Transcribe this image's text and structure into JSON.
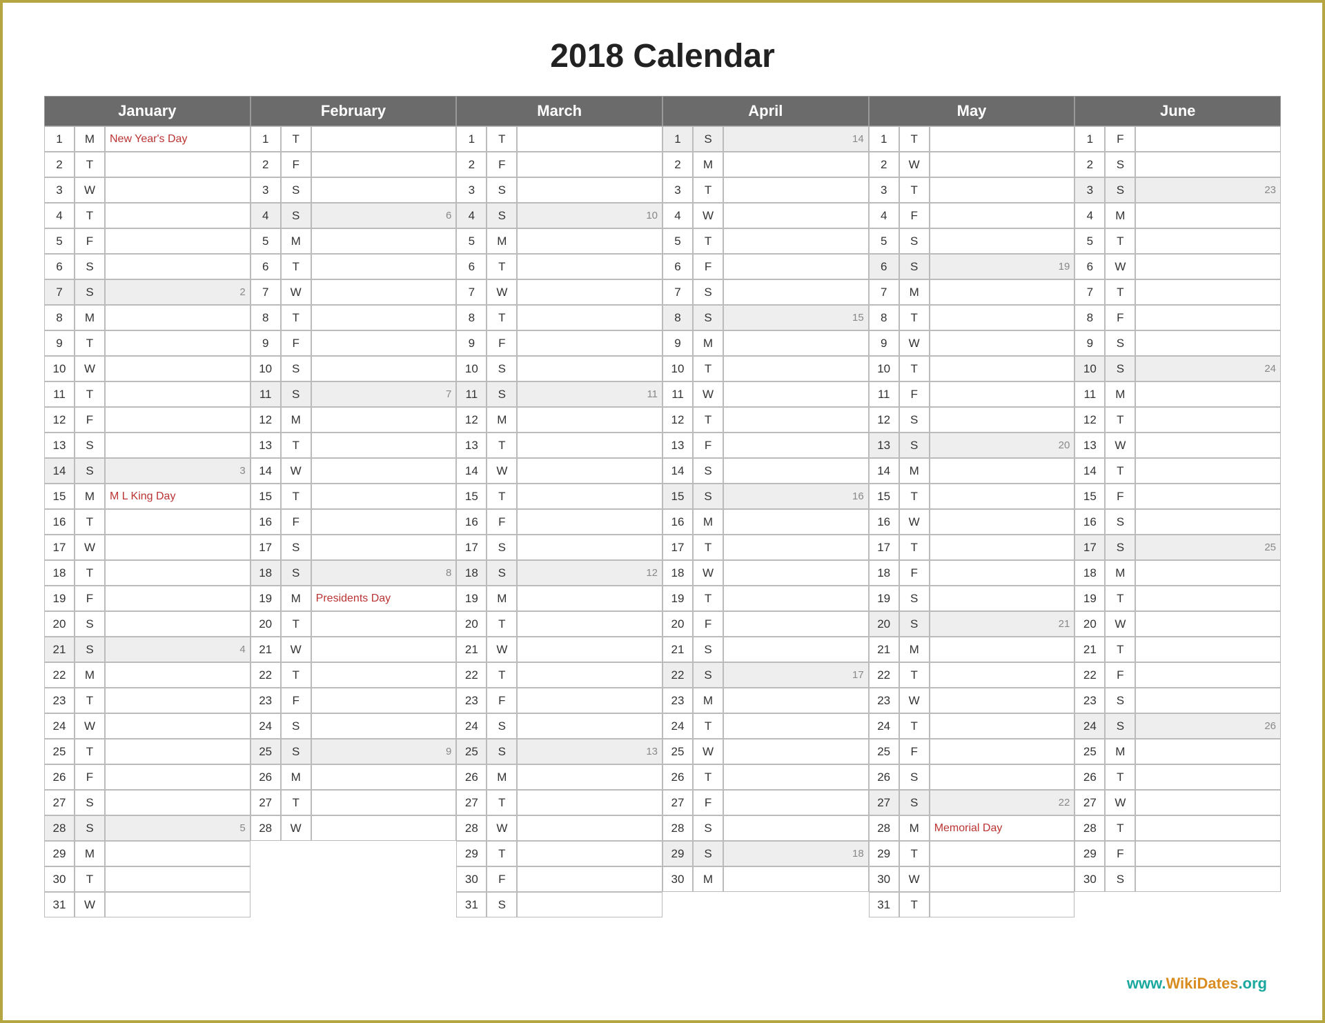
{
  "title": "2018 Calendar",
  "footer": {
    "text1": "www.",
    "text2": "WikiDates",
    "text3": ".org"
  },
  "months": [
    {
      "name": "January",
      "days": [
        {
          "n": "1",
          "d": "M",
          "ev": "New Year's Day",
          "wn": ""
        },
        {
          "n": "2",
          "d": "T",
          "ev": "",
          "wn": ""
        },
        {
          "n": "3",
          "d": "W",
          "ev": "",
          "wn": ""
        },
        {
          "n": "4",
          "d": "T",
          "ev": "",
          "wn": ""
        },
        {
          "n": "5",
          "d": "F",
          "ev": "",
          "wn": ""
        },
        {
          "n": "6",
          "d": "S",
          "ev": "",
          "wn": ""
        },
        {
          "n": "7",
          "d": "S",
          "ev": "",
          "wn": "2",
          "sun": true
        },
        {
          "n": "8",
          "d": "M",
          "ev": "",
          "wn": ""
        },
        {
          "n": "9",
          "d": "T",
          "ev": "",
          "wn": ""
        },
        {
          "n": "10",
          "d": "W",
          "ev": "",
          "wn": ""
        },
        {
          "n": "11",
          "d": "T",
          "ev": "",
          "wn": ""
        },
        {
          "n": "12",
          "d": "F",
          "ev": "",
          "wn": ""
        },
        {
          "n": "13",
          "d": "S",
          "ev": "",
          "wn": ""
        },
        {
          "n": "14",
          "d": "S",
          "ev": "",
          "wn": "3",
          "sun": true
        },
        {
          "n": "15",
          "d": "M",
          "ev": "M L King Day",
          "wn": ""
        },
        {
          "n": "16",
          "d": "T",
          "ev": "",
          "wn": ""
        },
        {
          "n": "17",
          "d": "W",
          "ev": "",
          "wn": ""
        },
        {
          "n": "18",
          "d": "T",
          "ev": "",
          "wn": ""
        },
        {
          "n": "19",
          "d": "F",
          "ev": "",
          "wn": ""
        },
        {
          "n": "20",
          "d": "S",
          "ev": "",
          "wn": ""
        },
        {
          "n": "21",
          "d": "S",
          "ev": "",
          "wn": "4",
          "sun": true
        },
        {
          "n": "22",
          "d": "M",
          "ev": "",
          "wn": ""
        },
        {
          "n": "23",
          "d": "T",
          "ev": "",
          "wn": ""
        },
        {
          "n": "24",
          "d": "W",
          "ev": "",
          "wn": ""
        },
        {
          "n": "25",
          "d": "T",
          "ev": "",
          "wn": ""
        },
        {
          "n": "26",
          "d": "F",
          "ev": "",
          "wn": ""
        },
        {
          "n": "27",
          "d": "S",
          "ev": "",
          "wn": ""
        },
        {
          "n": "28",
          "d": "S",
          "ev": "",
          "wn": "5",
          "sun": true
        },
        {
          "n": "29",
          "d": "M",
          "ev": "",
          "wn": ""
        },
        {
          "n": "30",
          "d": "T",
          "ev": "",
          "wn": ""
        },
        {
          "n": "31",
          "d": "W",
          "ev": "",
          "wn": ""
        }
      ]
    },
    {
      "name": "February",
      "days": [
        {
          "n": "1",
          "d": "T",
          "ev": "",
          "wn": ""
        },
        {
          "n": "2",
          "d": "F",
          "ev": "",
          "wn": ""
        },
        {
          "n": "3",
          "d": "S",
          "ev": "",
          "wn": ""
        },
        {
          "n": "4",
          "d": "S",
          "ev": "",
          "wn": "6",
          "sun": true
        },
        {
          "n": "5",
          "d": "M",
          "ev": "",
          "wn": ""
        },
        {
          "n": "6",
          "d": "T",
          "ev": "",
          "wn": ""
        },
        {
          "n": "7",
          "d": "W",
          "ev": "",
          "wn": ""
        },
        {
          "n": "8",
          "d": "T",
          "ev": "",
          "wn": ""
        },
        {
          "n": "9",
          "d": "F",
          "ev": "",
          "wn": ""
        },
        {
          "n": "10",
          "d": "S",
          "ev": "",
          "wn": ""
        },
        {
          "n": "11",
          "d": "S",
          "ev": "",
          "wn": "7",
          "sun": true
        },
        {
          "n": "12",
          "d": "M",
          "ev": "",
          "wn": ""
        },
        {
          "n": "13",
          "d": "T",
          "ev": "",
          "wn": ""
        },
        {
          "n": "14",
          "d": "W",
          "ev": "",
          "wn": ""
        },
        {
          "n": "15",
          "d": "T",
          "ev": "",
          "wn": ""
        },
        {
          "n": "16",
          "d": "F",
          "ev": "",
          "wn": ""
        },
        {
          "n": "17",
          "d": "S",
          "ev": "",
          "wn": ""
        },
        {
          "n": "18",
          "d": "S",
          "ev": "",
          "wn": "8",
          "sun": true
        },
        {
          "n": "19",
          "d": "M",
          "ev": "Presidents Day",
          "wn": ""
        },
        {
          "n": "20",
          "d": "T",
          "ev": "",
          "wn": ""
        },
        {
          "n": "21",
          "d": "W",
          "ev": "",
          "wn": ""
        },
        {
          "n": "22",
          "d": "T",
          "ev": "",
          "wn": ""
        },
        {
          "n": "23",
          "d": "F",
          "ev": "",
          "wn": ""
        },
        {
          "n": "24",
          "d": "S",
          "ev": "",
          "wn": ""
        },
        {
          "n": "25",
          "d": "S",
          "ev": "",
          "wn": "9",
          "sun": true
        },
        {
          "n": "26",
          "d": "M",
          "ev": "",
          "wn": ""
        },
        {
          "n": "27",
          "d": "T",
          "ev": "",
          "wn": ""
        },
        {
          "n": "28",
          "d": "W",
          "ev": "",
          "wn": ""
        }
      ]
    },
    {
      "name": "March",
      "days": [
        {
          "n": "1",
          "d": "T",
          "ev": "",
          "wn": ""
        },
        {
          "n": "2",
          "d": "F",
          "ev": "",
          "wn": ""
        },
        {
          "n": "3",
          "d": "S",
          "ev": "",
          "wn": ""
        },
        {
          "n": "4",
          "d": "S",
          "ev": "",
          "wn": "10",
          "sun": true
        },
        {
          "n": "5",
          "d": "M",
          "ev": "",
          "wn": ""
        },
        {
          "n": "6",
          "d": "T",
          "ev": "",
          "wn": ""
        },
        {
          "n": "7",
          "d": "W",
          "ev": "",
          "wn": ""
        },
        {
          "n": "8",
          "d": "T",
          "ev": "",
          "wn": ""
        },
        {
          "n": "9",
          "d": "F",
          "ev": "",
          "wn": ""
        },
        {
          "n": "10",
          "d": "S",
          "ev": "",
          "wn": ""
        },
        {
          "n": "11",
          "d": "S",
          "ev": "",
          "wn": "11",
          "sun": true
        },
        {
          "n": "12",
          "d": "M",
          "ev": "",
          "wn": ""
        },
        {
          "n": "13",
          "d": "T",
          "ev": "",
          "wn": ""
        },
        {
          "n": "14",
          "d": "W",
          "ev": "",
          "wn": ""
        },
        {
          "n": "15",
          "d": "T",
          "ev": "",
          "wn": ""
        },
        {
          "n": "16",
          "d": "F",
          "ev": "",
          "wn": ""
        },
        {
          "n": "17",
          "d": "S",
          "ev": "",
          "wn": ""
        },
        {
          "n": "18",
          "d": "S",
          "ev": "",
          "wn": "12",
          "sun": true
        },
        {
          "n": "19",
          "d": "M",
          "ev": "",
          "wn": ""
        },
        {
          "n": "20",
          "d": "T",
          "ev": "",
          "wn": ""
        },
        {
          "n": "21",
          "d": "W",
          "ev": "",
          "wn": ""
        },
        {
          "n": "22",
          "d": "T",
          "ev": "",
          "wn": ""
        },
        {
          "n": "23",
          "d": "F",
          "ev": "",
          "wn": ""
        },
        {
          "n": "24",
          "d": "S",
          "ev": "",
          "wn": ""
        },
        {
          "n": "25",
          "d": "S",
          "ev": "",
          "wn": "13",
          "sun": true
        },
        {
          "n": "26",
          "d": "M",
          "ev": "",
          "wn": ""
        },
        {
          "n": "27",
          "d": "T",
          "ev": "",
          "wn": ""
        },
        {
          "n": "28",
          "d": "W",
          "ev": "",
          "wn": ""
        },
        {
          "n": "29",
          "d": "T",
          "ev": "",
          "wn": ""
        },
        {
          "n": "30",
          "d": "F",
          "ev": "",
          "wn": ""
        },
        {
          "n": "31",
          "d": "S",
          "ev": "",
          "wn": ""
        }
      ]
    },
    {
      "name": "April",
      "days": [
        {
          "n": "1",
          "d": "S",
          "ev": "",
          "wn": "14",
          "sun": true
        },
        {
          "n": "2",
          "d": "M",
          "ev": "",
          "wn": ""
        },
        {
          "n": "3",
          "d": "T",
          "ev": "",
          "wn": ""
        },
        {
          "n": "4",
          "d": "W",
          "ev": "",
          "wn": ""
        },
        {
          "n": "5",
          "d": "T",
          "ev": "",
          "wn": ""
        },
        {
          "n": "6",
          "d": "F",
          "ev": "",
          "wn": ""
        },
        {
          "n": "7",
          "d": "S",
          "ev": "",
          "wn": ""
        },
        {
          "n": "8",
          "d": "S",
          "ev": "",
          "wn": "15",
          "sun": true
        },
        {
          "n": "9",
          "d": "M",
          "ev": "",
          "wn": ""
        },
        {
          "n": "10",
          "d": "T",
          "ev": "",
          "wn": ""
        },
        {
          "n": "11",
          "d": "W",
          "ev": "",
          "wn": ""
        },
        {
          "n": "12",
          "d": "T",
          "ev": "",
          "wn": ""
        },
        {
          "n": "13",
          "d": "F",
          "ev": "",
          "wn": ""
        },
        {
          "n": "14",
          "d": "S",
          "ev": "",
          "wn": ""
        },
        {
          "n": "15",
          "d": "S",
          "ev": "",
          "wn": "16",
          "sun": true
        },
        {
          "n": "16",
          "d": "M",
          "ev": "",
          "wn": ""
        },
        {
          "n": "17",
          "d": "T",
          "ev": "",
          "wn": ""
        },
        {
          "n": "18",
          "d": "W",
          "ev": "",
          "wn": ""
        },
        {
          "n": "19",
          "d": "T",
          "ev": "",
          "wn": ""
        },
        {
          "n": "20",
          "d": "F",
          "ev": "",
          "wn": ""
        },
        {
          "n": "21",
          "d": "S",
          "ev": "",
          "wn": ""
        },
        {
          "n": "22",
          "d": "S",
          "ev": "",
          "wn": "17",
          "sun": true
        },
        {
          "n": "23",
          "d": "M",
          "ev": "",
          "wn": ""
        },
        {
          "n": "24",
          "d": "T",
          "ev": "",
          "wn": ""
        },
        {
          "n": "25",
          "d": "W",
          "ev": "",
          "wn": ""
        },
        {
          "n": "26",
          "d": "T",
          "ev": "",
          "wn": ""
        },
        {
          "n": "27",
          "d": "F",
          "ev": "",
          "wn": ""
        },
        {
          "n": "28",
          "d": "S",
          "ev": "",
          "wn": ""
        },
        {
          "n": "29",
          "d": "S",
          "ev": "",
          "wn": "18",
          "sun": true
        },
        {
          "n": "30",
          "d": "M",
          "ev": "",
          "wn": ""
        }
      ]
    },
    {
      "name": "May",
      "days": [
        {
          "n": "1",
          "d": "T",
          "ev": "",
          "wn": ""
        },
        {
          "n": "2",
          "d": "W",
          "ev": "",
          "wn": ""
        },
        {
          "n": "3",
          "d": "T",
          "ev": "",
          "wn": ""
        },
        {
          "n": "4",
          "d": "F",
          "ev": "",
          "wn": ""
        },
        {
          "n": "5",
          "d": "S",
          "ev": "",
          "wn": ""
        },
        {
          "n": "6",
          "d": "S",
          "ev": "",
          "wn": "19",
          "sun": true
        },
        {
          "n": "7",
          "d": "M",
          "ev": "",
          "wn": ""
        },
        {
          "n": "8",
          "d": "T",
          "ev": "",
          "wn": ""
        },
        {
          "n": "9",
          "d": "W",
          "ev": "",
          "wn": ""
        },
        {
          "n": "10",
          "d": "T",
          "ev": "",
          "wn": ""
        },
        {
          "n": "11",
          "d": "F",
          "ev": "",
          "wn": ""
        },
        {
          "n": "12",
          "d": "S",
          "ev": "",
          "wn": ""
        },
        {
          "n": "13",
          "d": "S",
          "ev": "",
          "wn": "20",
          "sun": true
        },
        {
          "n": "14",
          "d": "M",
          "ev": "",
          "wn": ""
        },
        {
          "n": "15",
          "d": "T",
          "ev": "",
          "wn": ""
        },
        {
          "n": "16",
          "d": "W",
          "ev": "",
          "wn": ""
        },
        {
          "n": "17",
          "d": "T",
          "ev": "",
          "wn": ""
        },
        {
          "n": "18",
          "d": "F",
          "ev": "",
          "wn": ""
        },
        {
          "n": "19",
          "d": "S",
          "ev": "",
          "wn": ""
        },
        {
          "n": "20",
          "d": "S",
          "ev": "",
          "wn": "21",
          "sun": true
        },
        {
          "n": "21",
          "d": "M",
          "ev": "",
          "wn": ""
        },
        {
          "n": "22",
          "d": "T",
          "ev": "",
          "wn": ""
        },
        {
          "n": "23",
          "d": "W",
          "ev": "",
          "wn": ""
        },
        {
          "n": "24",
          "d": "T",
          "ev": "",
          "wn": ""
        },
        {
          "n": "25",
          "d": "F",
          "ev": "",
          "wn": ""
        },
        {
          "n": "26",
          "d": "S",
          "ev": "",
          "wn": ""
        },
        {
          "n": "27",
          "d": "S",
          "ev": "",
          "wn": "22",
          "sun": true
        },
        {
          "n": "28",
          "d": "M",
          "ev": "Memorial Day",
          "wn": ""
        },
        {
          "n": "29",
          "d": "T",
          "ev": "",
          "wn": ""
        },
        {
          "n": "30",
          "d": "W",
          "ev": "",
          "wn": ""
        },
        {
          "n": "31",
          "d": "T",
          "ev": "",
          "wn": ""
        }
      ]
    },
    {
      "name": "June",
      "days": [
        {
          "n": "1",
          "d": "F",
          "ev": "",
          "wn": ""
        },
        {
          "n": "2",
          "d": "S",
          "ev": "",
          "wn": ""
        },
        {
          "n": "3",
          "d": "S",
          "ev": "",
          "wn": "23",
          "sun": true
        },
        {
          "n": "4",
          "d": "M",
          "ev": "",
          "wn": ""
        },
        {
          "n": "5",
          "d": "T",
          "ev": "",
          "wn": ""
        },
        {
          "n": "6",
          "d": "W",
          "ev": "",
          "wn": ""
        },
        {
          "n": "7",
          "d": "T",
          "ev": "",
          "wn": ""
        },
        {
          "n": "8",
          "d": "F",
          "ev": "",
          "wn": ""
        },
        {
          "n": "9",
          "d": "S",
          "ev": "",
          "wn": ""
        },
        {
          "n": "10",
          "d": "S",
          "ev": "",
          "wn": "24",
          "sun": true
        },
        {
          "n": "11",
          "d": "M",
          "ev": "",
          "wn": ""
        },
        {
          "n": "12",
          "d": "T",
          "ev": "",
          "wn": ""
        },
        {
          "n": "13",
          "d": "W",
          "ev": "",
          "wn": ""
        },
        {
          "n": "14",
          "d": "T",
          "ev": "",
          "wn": ""
        },
        {
          "n": "15",
          "d": "F",
          "ev": "",
          "wn": ""
        },
        {
          "n": "16",
          "d": "S",
          "ev": "",
          "wn": ""
        },
        {
          "n": "17",
          "d": "S",
          "ev": "",
          "wn": "25",
          "sun": true
        },
        {
          "n": "18",
          "d": "M",
          "ev": "",
          "wn": ""
        },
        {
          "n": "19",
          "d": "T",
          "ev": "",
          "wn": ""
        },
        {
          "n": "20",
          "d": "W",
          "ev": "",
          "wn": ""
        },
        {
          "n": "21",
          "d": "T",
          "ev": "",
          "wn": ""
        },
        {
          "n": "22",
          "d": "F",
          "ev": "",
          "wn": ""
        },
        {
          "n": "23",
          "d": "S",
          "ev": "",
          "wn": ""
        },
        {
          "n": "24",
          "d": "S",
          "ev": "",
          "wn": "26",
          "sun": true
        },
        {
          "n": "25",
          "d": "M",
          "ev": "",
          "wn": ""
        },
        {
          "n": "26",
          "d": "T",
          "ev": "",
          "wn": ""
        },
        {
          "n": "27",
          "d": "W",
          "ev": "",
          "wn": ""
        },
        {
          "n": "28",
          "d": "T",
          "ev": "",
          "wn": ""
        },
        {
          "n": "29",
          "d": "F",
          "ev": "",
          "wn": ""
        },
        {
          "n": "30",
          "d": "S",
          "ev": "",
          "wn": ""
        }
      ]
    }
  ]
}
